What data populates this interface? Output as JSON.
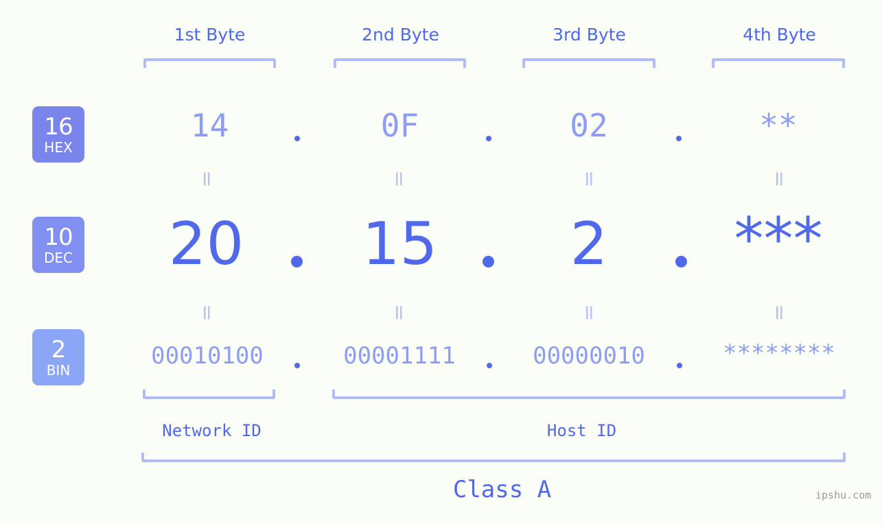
{
  "meta": {
    "background_color": "#fbfdf7",
    "accent_color": "#5068ea",
    "muted_accent_color": "#8e9cf2",
    "bracket_color": "#b0bcf7"
  },
  "byte_headers": [
    {
      "label": "1st Byte"
    },
    {
      "label": "2nd Byte"
    },
    {
      "label": "3rd Byte"
    },
    {
      "label": "4th Byte"
    }
  ],
  "bases": [
    {
      "number": "16",
      "name": "HEX",
      "color": "#7a85ec"
    },
    {
      "number": "10",
      "name": "DEC",
      "color": "#808ff0"
    },
    {
      "number": "2",
      "name": "BIN",
      "color": "#8ba6f6"
    }
  ],
  "rows": {
    "hex": {
      "base_number": "16",
      "base_name": "HEX",
      "values": [
        "14",
        "0F",
        "02",
        "**"
      ],
      "separator": "."
    },
    "dec": {
      "base_number": "10",
      "base_name": "DEC",
      "values": [
        "20",
        "15",
        "2",
        "***"
      ],
      "separator": "."
    },
    "bin": {
      "base_number": "2",
      "base_name": "BIN",
      "values": [
        "00010100",
        "00001111",
        "00000010",
        "********"
      ],
      "separator": "."
    }
  },
  "equals_sign": "=",
  "segments": {
    "network_id": "Network ID",
    "host_id": "Host ID",
    "class": "Class A"
  },
  "watermark": "ipshu.com"
}
